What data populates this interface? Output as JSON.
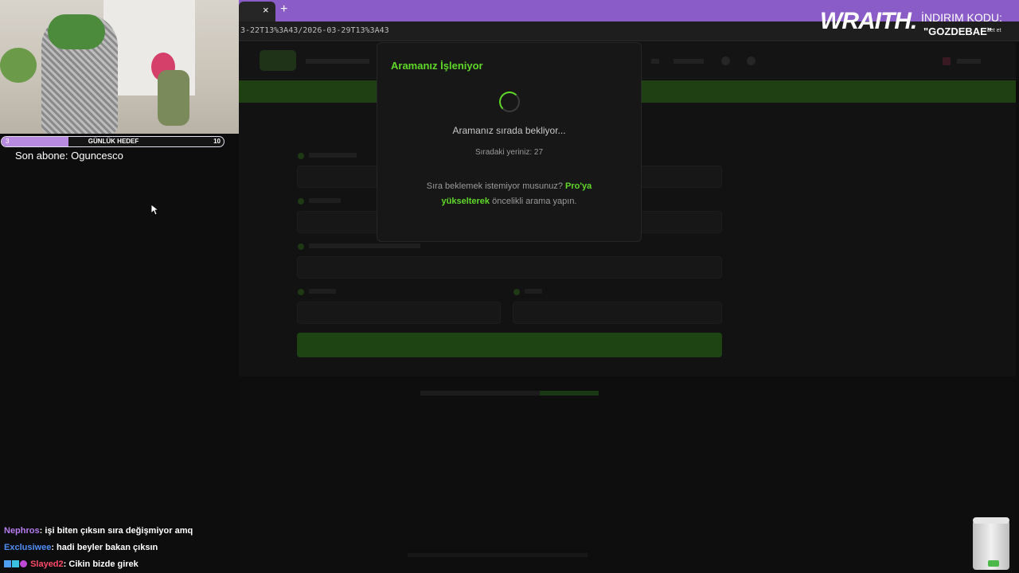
{
  "browser": {
    "tab_close": "×",
    "tab_new": "+",
    "url": "3-22T13%3A43/2026-03-29T13%3A43"
  },
  "modal": {
    "title": "Aramanız İşleniyor",
    "waiting": "Aramanız sırada bekliyor...",
    "queue_position": "Sıradaki yeriniz: 27",
    "upsell_before": "Sıra beklemek istemiyor musunuz? ",
    "upsell_link": "Pro'ya yükselterek",
    "upsell_after": " öncelikli arama yapın.",
    "accent_color": "#5fd82a"
  },
  "stream": {
    "goal": {
      "start": "3",
      "label": "GÜNLÜK HEDEF",
      "end": "10",
      "progress_fraction": 0.3
    },
    "latest_subscriber": "Son abone: Oguncesco",
    "sponsor": {
      "brand": "WRAITH.",
      "label": "İNDIRIM KODU:",
      "code": "\"GOZDEBAE\"",
      "ext": "bet et"
    },
    "chat": [
      {
        "user": "Nephros",
        "color": "#b67cf0",
        "message": ": işi biten çıksın sıra değişmiyor amq"
      },
      {
        "user": "Exclusiwee",
        "color": "#4f8ef5",
        "message": ": hadi beyler bakan çıksın"
      },
      {
        "user": "Slayed2",
        "color": "#ff4a6a",
        "message": ": Cikin bizde girek"
      }
    ]
  }
}
